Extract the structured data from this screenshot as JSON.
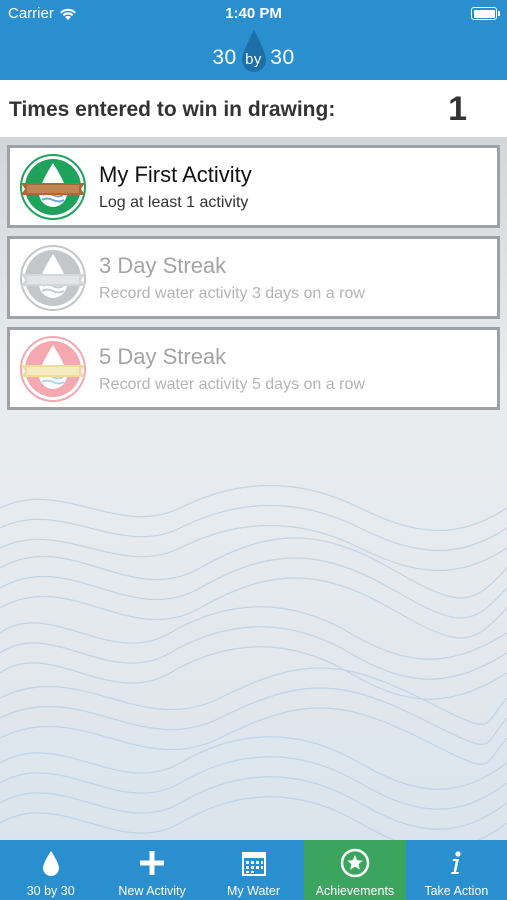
{
  "status_bar": {
    "carrier": "Carrier",
    "time": "1:40 PM"
  },
  "header": {
    "logo_left": "30",
    "logo_by": "by",
    "logo_right": "30"
  },
  "entries": {
    "label": "Times entered to win in drawing:",
    "count": "1"
  },
  "achievements": [
    {
      "title": "My First Activity",
      "description": "Log at least 1 activity",
      "unlocked": true,
      "badge_color": "#1fa35c"
    },
    {
      "title": "3 Day Streak",
      "description": "Record water activity 3 days on a row",
      "unlocked": false,
      "badge_color": "#c4c6c8"
    },
    {
      "title": "5 Day Streak",
      "description": "Record water activity 5 days on a row",
      "unlocked": false,
      "badge_color": "#f4a9b0"
    }
  ],
  "tabs": [
    {
      "label": "30 by 30",
      "icon": "drop-icon"
    },
    {
      "label": "New Activity",
      "icon": "plus-icon"
    },
    {
      "label": "My Water",
      "icon": "calendar-icon"
    },
    {
      "label": "Achievements",
      "icon": "star-badge-icon",
      "selected": true
    },
    {
      "label": "Take Action",
      "icon": "info-icon"
    }
  ],
  "colors": {
    "brand_blue": "#2a8fcf",
    "selected_tab": "#3ba560"
  }
}
